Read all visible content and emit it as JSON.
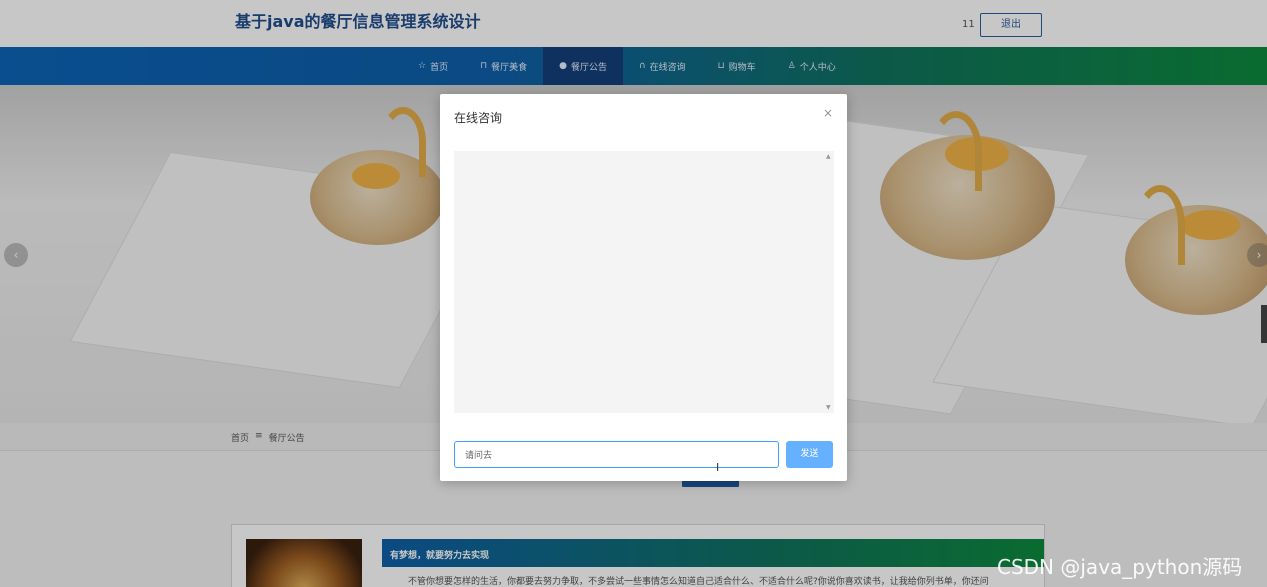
{
  "header": {
    "site_title": "基于java的餐厅信息管理系统设计",
    "user_name": "11",
    "logout_label": "退出"
  },
  "nav": {
    "items": [
      {
        "label": "首页",
        "icon": "star-icon",
        "glyph": "☆"
      },
      {
        "label": "餐厅美食",
        "icon": "bag-icon",
        "glyph": "⊓"
      },
      {
        "label": "餐厅公告",
        "icon": "info-icon",
        "glyph": "●"
      },
      {
        "label": "在线咨询",
        "icon": "headset-icon",
        "glyph": "∩"
      },
      {
        "label": "购物车",
        "icon": "cart-icon",
        "glyph": "⊔"
      },
      {
        "label": "个人中心",
        "icon": "user-icon",
        "glyph": "♙"
      }
    ],
    "active_index": 2
  },
  "banner": {
    "prev_glyph": "‹",
    "next_glyph": "›"
  },
  "breadcrumb": {
    "home": "首页",
    "separator": "≡",
    "current": "餐厅公告"
  },
  "news": {
    "title": "有梦想，就要努力去实现",
    "excerpt": "不管你想要怎样的生活，你都要去努力争取，不多尝试一些事情怎么知道自己适合什么、不适合什么呢?你说你喜欢读书，让我给你列书单，你还问"
  },
  "modal": {
    "title": "在线咨询",
    "close_glyph": "×",
    "input_value": "请问去",
    "send_label": "发送",
    "scroll_up_glyph": "▲",
    "scroll_down_glyph": "▼"
  },
  "colors": {
    "nav_gradient_start": "#0d64b8",
    "nav_gradient_end": "#0e8a3e",
    "nav_active": "#123f7a",
    "send_button": "#66b1ff",
    "title_color": "#1f4e8c"
  },
  "watermark": "CSDN @java_python源码"
}
